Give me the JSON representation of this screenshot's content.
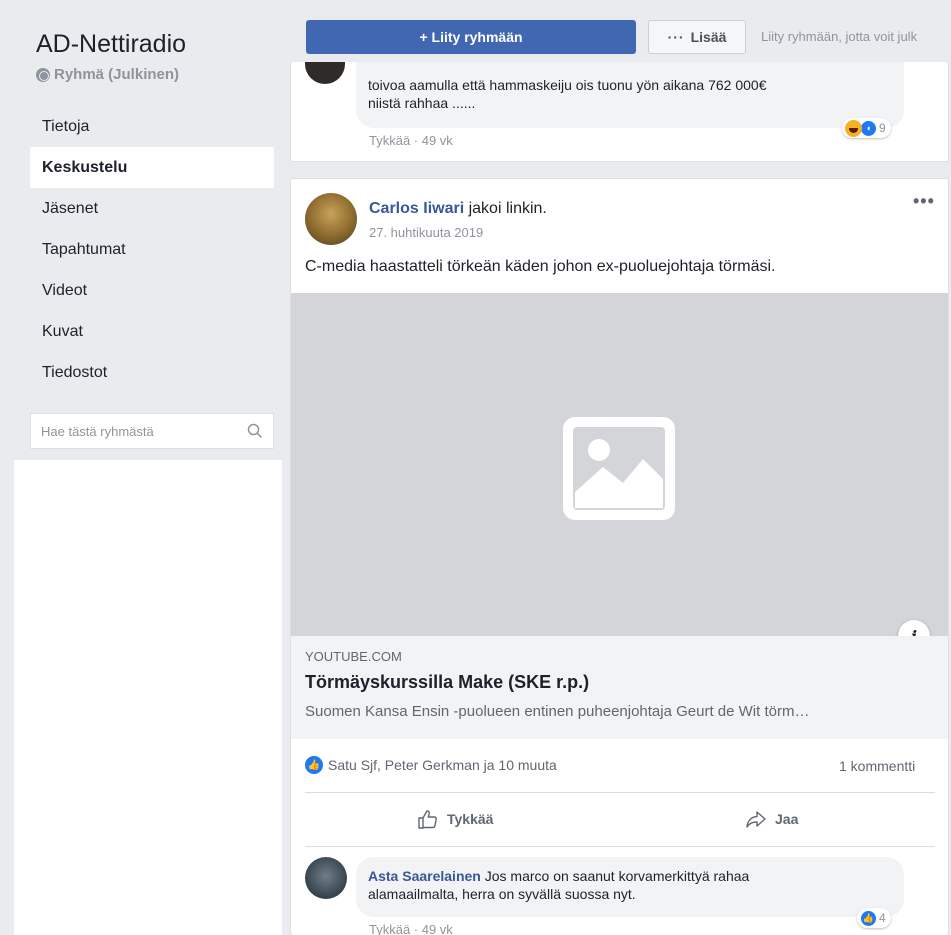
{
  "sidebar": {
    "group_name": "AD-Nettiradio",
    "group_type": "Ryhmä (Julkinen)",
    "nav": [
      {
        "label": "Tietoja",
        "active": false
      },
      {
        "label": "Keskustelu",
        "active": true
      },
      {
        "label": "Jäsenet",
        "active": false
      },
      {
        "label": "Tapahtumat",
        "active": false
      },
      {
        "label": "Videot",
        "active": false
      },
      {
        "label": "Kuvat",
        "active": false
      },
      {
        "label": "Tiedostot",
        "active": false
      }
    ],
    "search_placeholder": "Hae tästä ryhmästä"
  },
  "topbar": {
    "join_label": "+ Liity ryhmään",
    "more_label": "Lisää",
    "join_hint": "Liity ryhmään, jotta voit julk"
  },
  "previous_comment": {
    "text_line1": "toivoa aamulla että hammaskeiju ois tuonu yön aikana 762 000€",
    "text_line2": "niistä rahhaa ......",
    "meta": "Tykkää · 49 vk",
    "reaction_count": "9"
  },
  "post": {
    "author": "Carlos Iiwari",
    "action": " jakoi linkin.",
    "date": "27. huhtikuuta 2019",
    "menu": "•••",
    "text": "C-media haastatteli törkeän käden johon ex-puoluejohtaja törmäsi.",
    "link": {
      "domain": "YOUTUBE.COM",
      "title": "Törmäyskurssilla Make (SKE r.p.)",
      "description": "Suomen Kansa Ensin -puolueen entinen puheenjohtaja Geurt de Wit törm…",
      "info_icon": "i"
    },
    "likes_text": "Satu Sjf, Peter Gerkman ja 10 muuta",
    "comment_count": "1 kommentti",
    "actions": {
      "like": "Tykkää",
      "share": "Jaa"
    }
  },
  "comment": {
    "author": "Asta Saarelainen",
    "text_line1": " Jos marco on saanut korvamerkittyä rahaa",
    "text_line2": "alamaailmalta, herra on syvällä suossa nyt.",
    "meta": "Tykkää · 49 vk",
    "reaction_count": "4"
  },
  "colors": {
    "accent": "#4267b2",
    "link": "#385898",
    "background": "#e9ebee"
  }
}
